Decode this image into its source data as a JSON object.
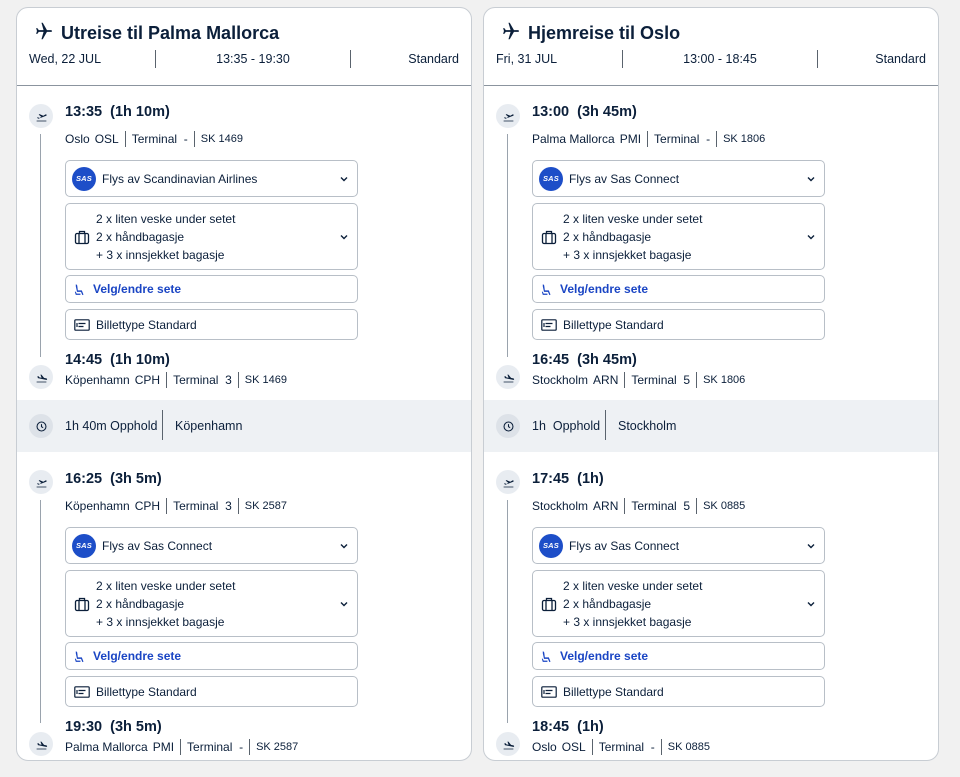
{
  "panels": [
    {
      "title": "Utreise til Palma Mallorca",
      "date": "Wed, 22 JUL",
      "time_range": "13:35 - 19:30",
      "fare_class": "Standard",
      "segments": [
        {
          "depart_time": "13:35",
          "depart_duration": "(1h 10m)",
          "depart_city": "Oslo",
          "depart_code": "OSL",
          "depart_terminal_label": "Terminal",
          "depart_terminal": "-",
          "flight_no": "SK 1469",
          "operator": "Flys av Scandinavian Airlines",
          "bag_lines": [
            "2 x liten veske under setet",
            "2 x håndbagasje",
            "+ 3 x innsjekket bagasje"
          ],
          "seat_label": "Velg/endre sete",
          "ticket_label": "Billettype Standard",
          "arrive_time": "14:45",
          "arrive_duration": "(1h 10m)",
          "arrive_city": "Köpenhamn",
          "arrive_code": "CPH",
          "arrive_terminal_label": "Terminal",
          "arrive_terminal": "3",
          "arrive_flight_no": "SK 1469"
        },
        {
          "depart_time": "16:25",
          "depart_duration": "(3h 5m)",
          "depart_city": "Köpenhamn",
          "depart_code": "CPH",
          "depart_terminal_label": "Terminal",
          "depart_terminal": "3",
          "flight_no": "SK 2587",
          "operator": "Flys av Sas Connect",
          "bag_lines": [
            "2 x liten veske under setet",
            "2 x håndbagasje",
            "+ 3 x innsjekket bagasje"
          ],
          "seat_label": "Velg/endre sete",
          "ticket_label": "Billettype Standard",
          "arrive_time": "19:30",
          "arrive_duration": "(3h 5m)",
          "arrive_city": "Palma Mallorca",
          "arrive_code": "PMI",
          "arrive_terminal_label": "Terminal",
          "arrive_terminal": "-",
          "arrive_flight_no": "SK 2587"
        }
      ],
      "layover": {
        "duration": "1h 40m Opphold",
        "city": "Köpenhamn"
      }
    },
    {
      "title": "Hjemreise til Oslo",
      "date": "Fri, 31 JUL",
      "time_range": "13:00 - 18:45",
      "fare_class": "Standard",
      "segments": [
        {
          "depart_time": "13:00",
          "depart_duration": "(3h 45m)",
          "depart_city": "Palma Mallorca",
          "depart_code": "PMI",
          "depart_terminal_label": "Terminal",
          "depart_terminal": "-",
          "flight_no": "SK 1806",
          "operator": "Flys av Sas Connect",
          "bag_lines": [
            "2 x liten veske under setet",
            "2 x håndbagasje",
            "+ 3 x innsjekket bagasje"
          ],
          "seat_label": "Velg/endre sete",
          "ticket_label": "Billettype Standard",
          "arrive_time": "16:45",
          "arrive_duration": "(3h 45m)",
          "arrive_city": "Stockholm",
          "arrive_code": "ARN",
          "arrive_terminal_label": "Terminal",
          "arrive_terminal": "5",
          "arrive_flight_no": "SK 1806"
        },
        {
          "depart_time": "17:45",
          "depart_duration": "(1h)",
          "depart_city": "Stockholm",
          "depart_code": "ARN",
          "depart_terminal_label": "Terminal",
          "depart_terminal": "5",
          "flight_no": "SK 0885",
          "operator": "Flys av Sas Connect",
          "bag_lines": [
            "2 x liten veske under setet",
            "2 x håndbagasje",
            "+ 3 x innsjekket bagasje"
          ],
          "seat_label": "Velg/endre sete",
          "ticket_label": "Billettype Standard",
          "arrive_time": "18:45",
          "arrive_duration": "(1h)",
          "arrive_city": "Oslo",
          "arrive_code": "OSL",
          "arrive_terminal_label": "Terminal",
          "arrive_terminal": "-",
          "arrive_flight_no": "SK 0885"
        }
      ],
      "layover": {
        "duration": "1h  Opphold",
        "city": "Stockholm"
      }
    }
  ],
  "airline_logo_text": "SAS",
  "icons": {
    "header_plane": "airplane-icon",
    "takeoff": "takeoff-icon",
    "landing": "landing-icon",
    "clock": "clock-icon",
    "bag": "luggage-icon",
    "seat": "seat-icon",
    "ticket": "ticket-icon",
    "chevron": "chevron-down-icon"
  },
  "colors": {
    "link_blue": "#1a45c4",
    "sas_blue": "#1d4ec8",
    "text": "#0b1f3a",
    "layover_bg": "#eef1f4"
  }
}
